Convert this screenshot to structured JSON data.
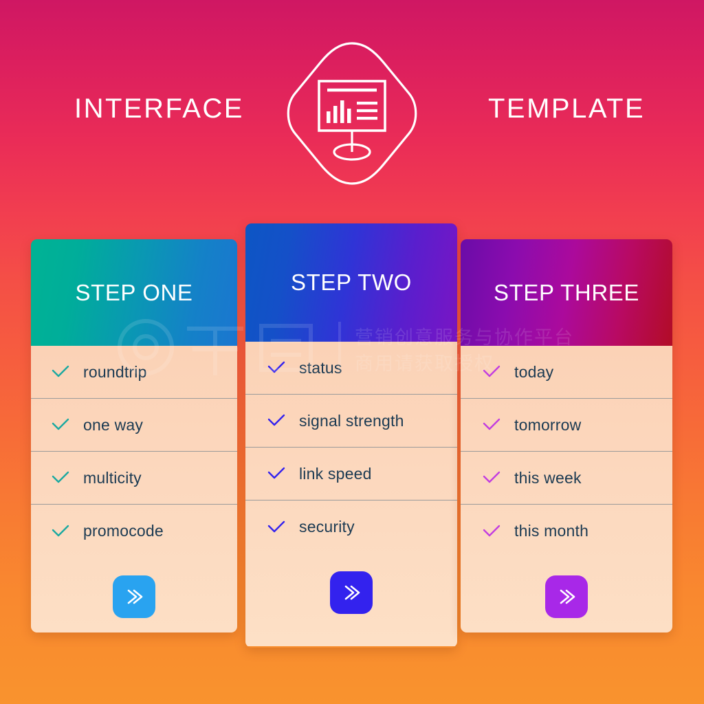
{
  "header": {
    "left_word": "INTERFACE",
    "right_word": "TEMPLATE",
    "icon_name": "presentation-chart-icon"
  },
  "colors": {
    "background_top": "#cf1763",
    "background_bottom": "#f9932e",
    "card_body": "#fcd8be",
    "row_text": "#1b3a52",
    "separator": "#9a9a9a",
    "card1_head_from": "#00b394",
    "card1_head_to": "#1b76d0",
    "card1_check": "#1aa9a0",
    "card1_button": "#29a3f0",
    "card2_head_from": "#0d56c4",
    "card2_head_to": "#7a15c4",
    "card2_check": "#3322ee",
    "card2_button": "#3322ee",
    "card3_head_from": "#6a0ca8",
    "card3_head_to": "#b20c26",
    "card3_check": "#c23de0",
    "card3_button": "#a828e8"
  },
  "cards": [
    {
      "title": "STEP ONE",
      "items": [
        "roundtrip",
        "one way",
        "multicity",
        "promocode"
      ],
      "button_label": "»",
      "button_icon": "double-chevron-right-icon"
    },
    {
      "title": "STEP TWO",
      "items": [
        "status",
        "signal strength",
        "link speed",
        "security"
      ],
      "button_label": "»",
      "button_icon": "double-chevron-right-icon"
    },
    {
      "title": "STEP THREE",
      "items": [
        "today",
        "tomorrow",
        "this week",
        "this month"
      ],
      "button_label": "»",
      "button_icon": "double-chevron-right-icon"
    }
  ],
  "watermark": {
    "line1": "营销创意服务与协作平台",
    "line2": "商用请获取授权",
    "logo_text": "千图"
  }
}
